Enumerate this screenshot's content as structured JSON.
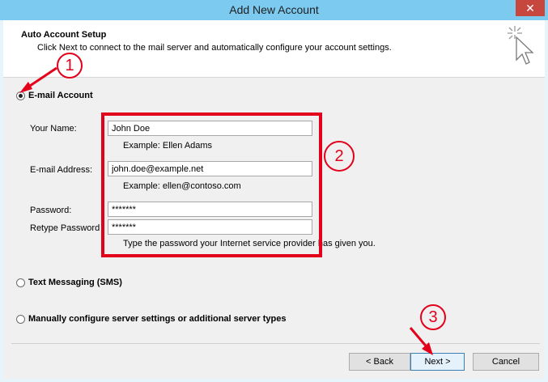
{
  "window": {
    "title": "Add New Account",
    "close_glyph": "✕"
  },
  "header": {
    "title": "Auto Account Setup",
    "subtitle": "Click Next to connect to the mail server and automatically configure your account settings."
  },
  "options": {
    "email_account": "E-mail Account",
    "sms": "Text Messaging (SMS)",
    "manual": "Manually configure server settings or additional server types"
  },
  "form": {
    "your_name_label": "Your Name:",
    "your_name_value": "John Doe",
    "your_name_hint": "Example: Ellen Adams",
    "email_label": "E-mail Address:",
    "email_value": "john.doe@example.net",
    "email_hint": "Example: ellen@contoso.com",
    "password_label": "Password:",
    "password_value": "*******",
    "retype_label": "Retype Password",
    "retype_value": "*******",
    "password_hint": "Type the password your Internet service provider has given you."
  },
  "buttons": {
    "back": "< Back",
    "next": "Next >",
    "cancel": "Cancel"
  },
  "annotations": {
    "step1": "1",
    "step2": "2",
    "step3": "3"
  },
  "colors": {
    "titlebar": "#7ccaf0",
    "annotation_red": "#e3001b",
    "close_red": "#c7463e"
  }
}
